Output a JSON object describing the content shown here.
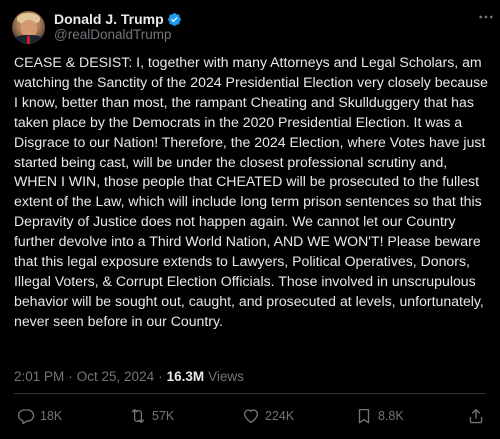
{
  "author": {
    "display_name": "Donald J. Trump",
    "handle": "@realDonaldTrump",
    "verified": true
  },
  "post": {
    "text": "CEASE & DESIST: I, together with many Attorneys and Legal Scholars, am watching the Sanctity of the 2024 Presidential Election very closely because I know, better than most, the rampant Cheating and Skullduggery that has taken place by the Democrats in the 2020 Presidential Election. It was a Disgrace to our Nation! Therefore, the 2024 Election, where Votes have just started being cast, will be under the closest professional scrutiny and, WHEN I WIN, those people that CHEATED will be prosecuted to the fullest extent of the Law, which will include long term prison sentences so that this Depravity of Justice does not happen again. We cannot let our Country further devolve into a Third World Nation, AND WE WON'T! Please beware that this legal exposure extends to Lawyers, Political Operatives, Donors, Illegal Voters, & Corrupt Election Officials. Those involved in unscrupulous behavior will be sought out, caught, and prosecuted at levels, unfortunately, never seen before in our Country."
  },
  "meta": {
    "time": "2:01 PM",
    "separator": "·",
    "date": "Oct 25, 2024",
    "views_count": "16.3M",
    "views_label": "Views"
  },
  "actions": {
    "reply_count": "18K",
    "repost_count": "57K",
    "like_count": "224K",
    "bookmark_count": "8.8K"
  },
  "icons": {
    "verified": "verified-badge-icon",
    "more": "more-icon",
    "reply": "reply-icon",
    "repost": "repost-icon",
    "like": "heart-icon",
    "bookmark": "bookmark-icon",
    "share": "share-icon"
  },
  "colors": {
    "background": "#000000",
    "text": "#e7e9ea",
    "secondary": "#71767b",
    "verified": "#1d9bf0",
    "divider": "#2f3336"
  }
}
